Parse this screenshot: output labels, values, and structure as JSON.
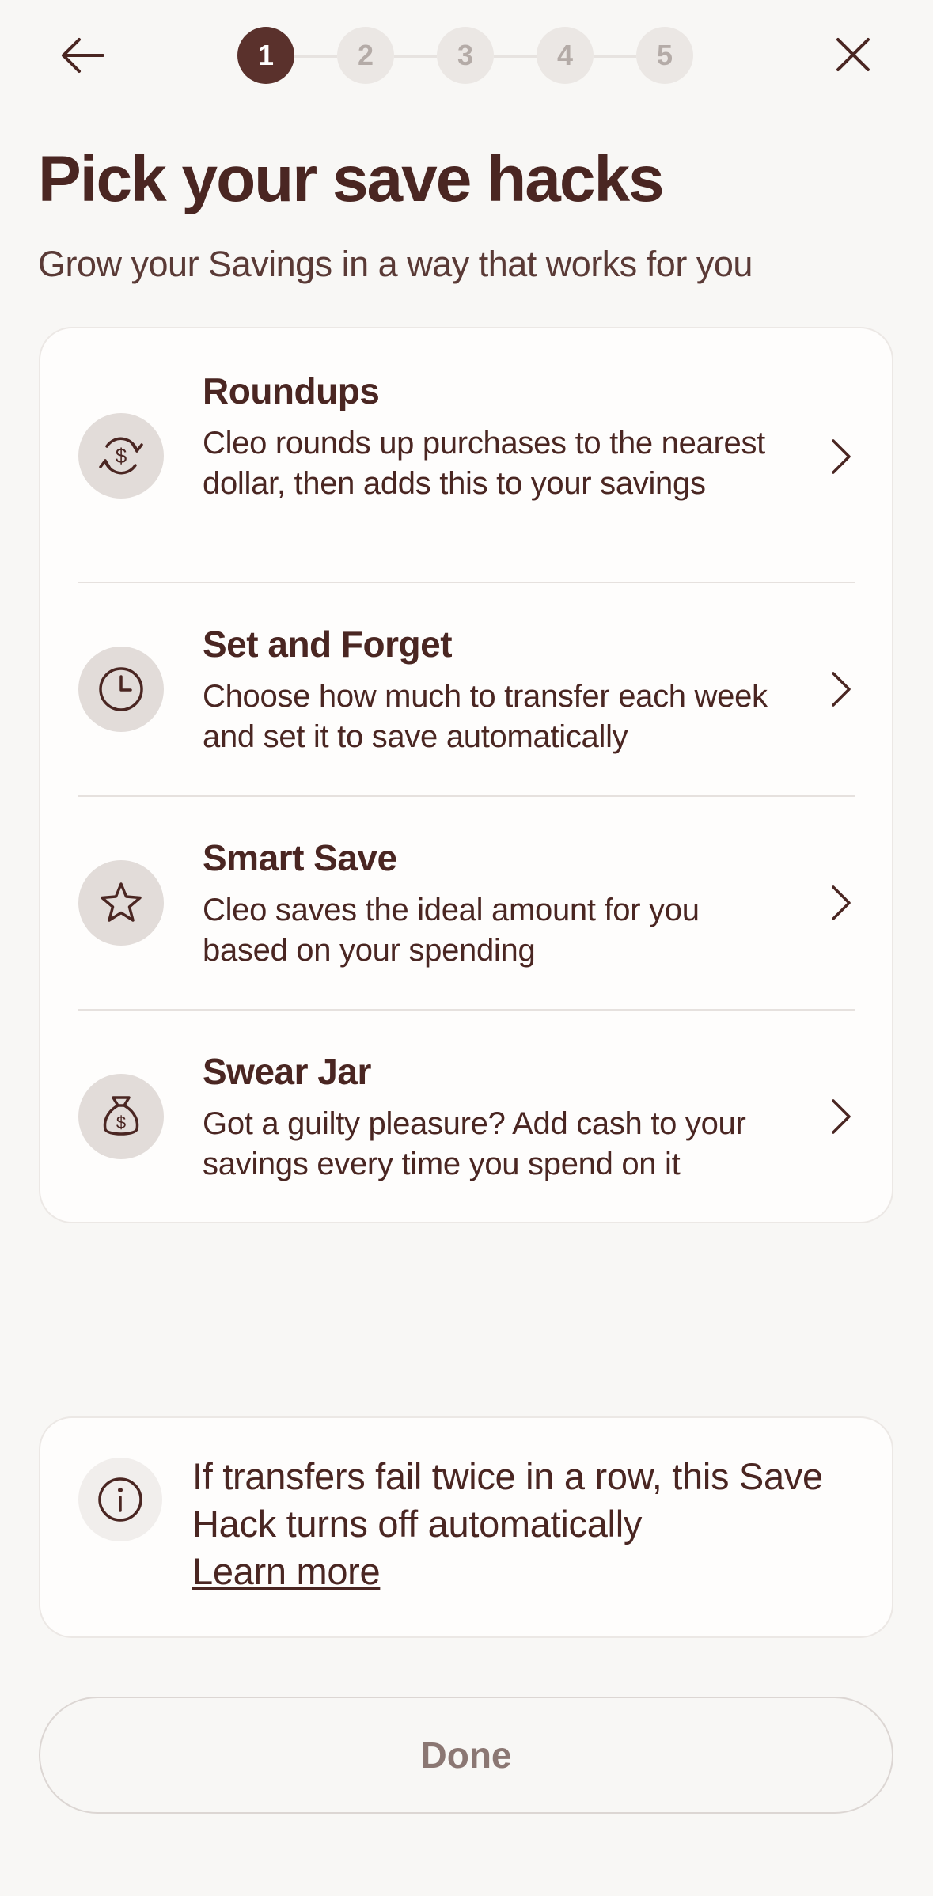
{
  "header": {
    "back_icon": "arrow-left-icon",
    "close_icon": "close-icon",
    "steps": [
      "1",
      "2",
      "3",
      "4",
      "5"
    ],
    "active_step": 1
  },
  "title": "Pick your save hacks",
  "subtitle": "Grow your Savings in a way that works for you",
  "hacks": [
    {
      "name": "Roundups",
      "description": "Cleo rounds up purchases to the nearest dollar, then adds this to your savings",
      "icon": "dollar-refresh-icon"
    },
    {
      "name": "Set and Forget",
      "description": "Choose how much to transfer each week and set it to save automatically",
      "icon": "clock-icon"
    },
    {
      "name": "Smart Save",
      "description": "Cleo saves the ideal amount for you based on your spending",
      "icon": "star-icon"
    },
    {
      "name": "Swear Jar",
      "description": "Got a guilty pleasure? Add cash to your savings every time you spend on it",
      "icon": "money-bag-icon"
    }
  ],
  "info": {
    "text": "If transfers fail twice in a row, this Save Hack turns off automatically",
    "link": "Learn more",
    "icon": "info-icon"
  },
  "done_label": "Done",
  "colors": {
    "background": "#f8f7f5",
    "text": "#4a2622",
    "active_step": "#5a312c",
    "icon_bg": "#e2dcd9"
  }
}
